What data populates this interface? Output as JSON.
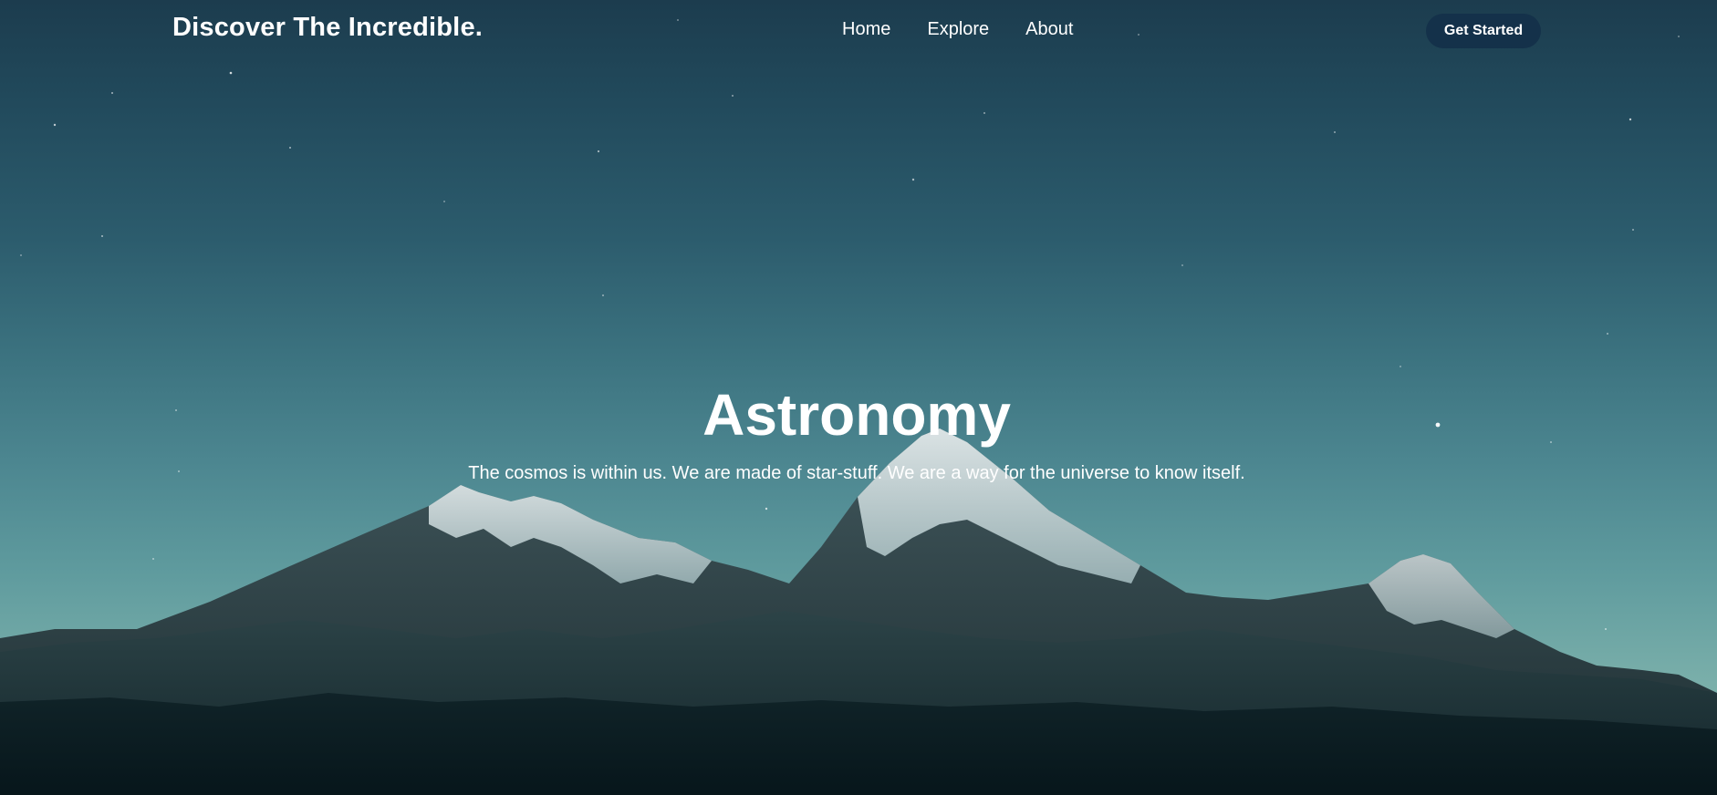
{
  "header": {
    "brand": "Discover The Incredible.",
    "nav": [
      {
        "label": "Home"
      },
      {
        "label": "Explore"
      },
      {
        "label": "About"
      }
    ],
    "cta_label": "Get Started"
  },
  "hero": {
    "title": "Astronomy",
    "subtitle": "The cosmos is within us. We are made of star-stuff. We are a way for the universe to know itself."
  },
  "colors": {
    "sky_top": "#1c3c4e",
    "sky_bottom": "#86b8ae",
    "cta_background": "#14314a",
    "text": "#ffffff"
  }
}
